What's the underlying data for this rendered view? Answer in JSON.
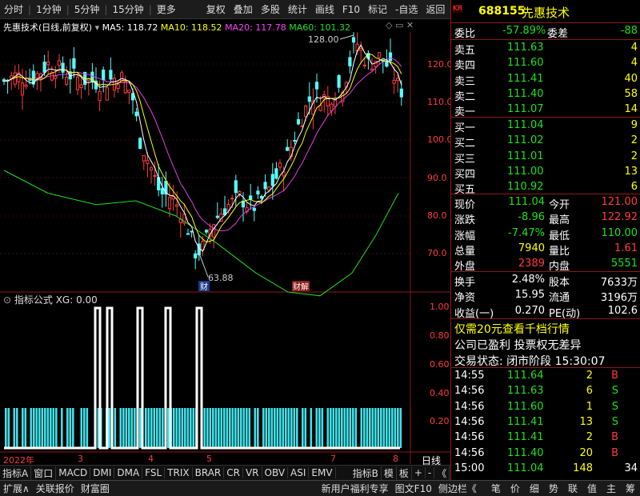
{
  "toolbar": {
    "items": [
      "分时",
      "1分钟",
      "5分钟",
      "15分钟",
      "更多",
      "复权",
      "叠加",
      "多股",
      "统计",
      "画线",
      "F10",
      "标记",
      "-自选",
      "返回"
    ]
  },
  "title": {
    "name": "先惠技术",
    "period": "(日线,前复权)",
    "ma5": "MA5: 118.72",
    "ma10": "MA10: 118.52",
    "ma20": "MA20: 117.78",
    "ma60": "MA60: 101.32"
  },
  "price_axis": [
    "120.0",
    "110.0",
    "100.0",
    "90.0",
    "80.0",
    "70.0"
  ],
  "markers": {
    "high": "128.00",
    "low": "63.88",
    "tag1": "财",
    "tag2": "财解"
  },
  "indicator": {
    "title": "指标公式 XG: 0.00",
    "axis": [
      "1.00",
      "0.80",
      "0.60",
      "0.40",
      "0.20"
    ]
  },
  "date_axis": {
    "labels": [
      "2022年",
      "3",
      "4",
      "5",
      "7",
      "8"
    ],
    "right": "日线"
  },
  "ind_tabs": [
    "指标A",
    "窗口",
    "MACD",
    "DMI",
    "DMA",
    "FSL",
    "TRIX",
    "BRAR",
    "CR",
    "VR",
    "OBV",
    "ASI",
    "EMV",
    "指标B",
    "模",
    "板",
    "+",
    "-",
    "《"
  ],
  "bottom": {
    "items": [
      "扩展∧",
      "关联报价",
      "财富圈"
    ],
    "right": [
      "新用户福利专享",
      "图文F10",
      "侧边栏《"
    ],
    "nav": [
      "笔",
      "价",
      "细",
      "势",
      "联",
      "值",
      "主",
      "筹"
    ]
  },
  "quote": {
    "code": "688155",
    "name": "先惠技术",
    "kr": "KR",
    "webi_label": "委比",
    "webi": "-57.89%",
    "weicha_label": "委差",
    "weicha": "-88",
    "asks": [
      {
        "l": "卖五",
        "p": "111.63",
        "v": "4"
      },
      {
        "l": "卖四",
        "p": "111.60",
        "v": "4"
      },
      {
        "l": "卖三",
        "p": "111.41",
        "v": "40"
      },
      {
        "l": "卖二",
        "p": "111.40",
        "v": "58"
      },
      {
        "l": "卖一",
        "p": "111.07",
        "v": "14"
      }
    ],
    "bids": [
      {
        "l": "买一",
        "p": "111.04",
        "v": "9"
      },
      {
        "l": "买二",
        "p": "111.02",
        "v": "2"
      },
      {
        "l": "买三",
        "p": "111.01",
        "v": "2"
      },
      {
        "l": "买四",
        "p": "111.00",
        "v": "13"
      },
      {
        "l": "买五",
        "p": "110.92",
        "v": "6"
      }
    ],
    "stats": [
      {
        "l": "现价",
        "v": "111.04",
        "l2": "今开",
        "v2": "121.00"
      },
      {
        "l": "涨跌",
        "v": "-8.96",
        "l2": "最高",
        "v2": "122.92"
      },
      {
        "l": "涨幅",
        "v": "-7.47%",
        "l2": "最低",
        "v2": "110.00"
      },
      {
        "l": "总量",
        "v": "7940",
        "l2": "量比",
        "v2": "1.61"
      },
      {
        "l": "外盘",
        "v": "2389",
        "l2": "内盘",
        "v2": "5551"
      }
    ],
    "stats2": [
      {
        "l": "换手",
        "v": "2.48%",
        "l2": "股本",
        "v2": "7633万"
      },
      {
        "l": "净资",
        "v": "15.95",
        "l2": "流通",
        "v2": "3196万"
      },
      {
        "l": "收益(一)",
        "v": "0.270",
        "l2": "PE(动)",
        "v2": "102.6"
      }
    ],
    "promo": "仅需20元查看千档行情",
    "notice": "公司已盈利 投票权无差异",
    "status": "交易状态: 闭市阶段 15:30:07",
    "trades": [
      {
        "t": "14:55",
        "p": "111.64",
        "v": "2",
        "s": "B"
      },
      {
        "t": "14:56",
        "p": "111.63",
        "v": "6",
        "s": "S"
      },
      {
        "t": "14:56",
        "p": "111.60",
        "v": "1",
        "s": "S"
      },
      {
        "t": "14:56",
        "p": "111.41",
        "v": "13",
        "s": "S"
      },
      {
        "t": "14:56",
        "p": "111.41",
        "v": "2",
        "s": "B"
      },
      {
        "t": "14:56",
        "p": "111.40",
        "v": "20",
        "s": "B"
      },
      {
        "t": "15:00",
        "p": "111.04",
        "v": "148",
        "s": "34"
      }
    ]
  }
}
